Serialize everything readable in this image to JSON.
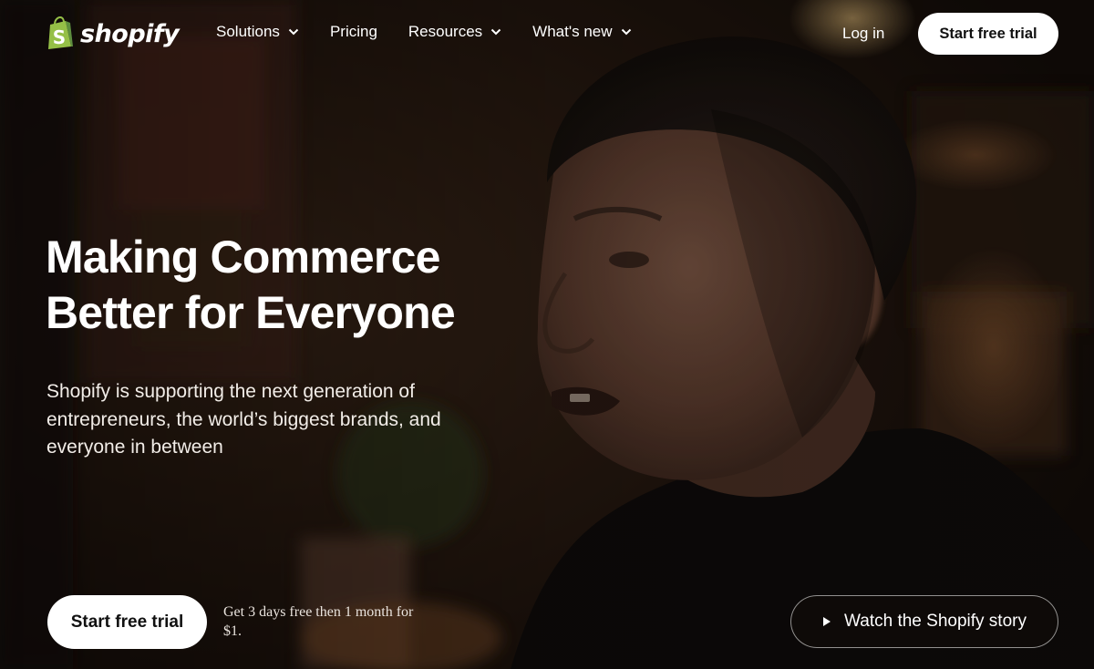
{
  "header": {
    "logo_text": "shopify",
    "logo_icon": "shopping-bag-icon",
    "nav": [
      {
        "label": "Solutions",
        "has_dropdown": true
      },
      {
        "label": "Pricing",
        "has_dropdown": false
      },
      {
        "label": "Resources",
        "has_dropdown": true
      },
      {
        "label": "What's new",
        "has_dropdown": true
      }
    ],
    "login_label": "Log in",
    "cta_label": "Start free trial"
  },
  "hero": {
    "title_line1": "Making Commerce",
    "title_line2": "Better for Everyone",
    "subtitle": "Shopify is supporting the next generation of entrepreneurs, the world’s biggest brands, and everyone in between"
  },
  "footer_cta": {
    "button_label": "Start free trial",
    "offer_text": "Get 3 days free then 1 month for $1.",
    "watch_label": "Watch the Shopify story",
    "watch_icon": "play-icon"
  },
  "colors": {
    "brand_green": "#95bf47",
    "brand_green_dark": "#5e8e3e",
    "button_bg": "#ffffff",
    "button_text": "#111111",
    "hero_text": "#ffffff"
  }
}
